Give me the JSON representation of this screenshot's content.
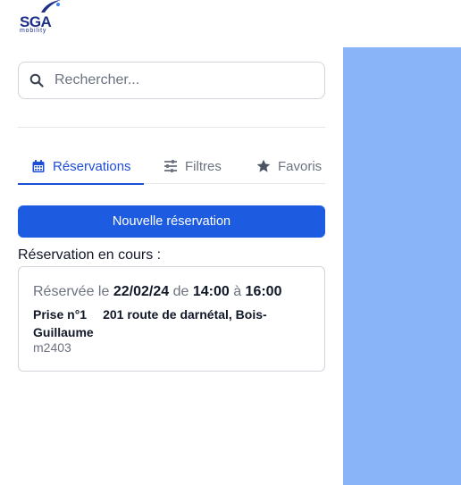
{
  "brand": {
    "name": "SGA",
    "tagline": "mobility",
    "color": "#1e2f86"
  },
  "search": {
    "placeholder": "Rechercher..."
  },
  "tabs": [
    {
      "label": "Réservations",
      "icon": "calendar-icon",
      "active": true
    },
    {
      "label": "Filtres",
      "icon": "sliders-icon",
      "active": false
    },
    {
      "label": "Favoris",
      "icon": "star-icon",
      "active": false
    }
  ],
  "actions": {
    "new_reservation": "Nouvelle réservation"
  },
  "current_reservation": {
    "title": "Réservation en cours :",
    "reserved_label": "Réservée le",
    "date": "22/02/24",
    "from_label": "de",
    "start_time": "14:00",
    "to_label": "à",
    "end_time": "16:00",
    "socket": "Prise n°1",
    "address": "201 route de darnétal, Bois-Guillaume",
    "vehicle": "m2403"
  },
  "colors": {
    "accent": "#1d5be0",
    "active_tab": "#1d4ed8",
    "map_panel": "#8ab4f8"
  }
}
